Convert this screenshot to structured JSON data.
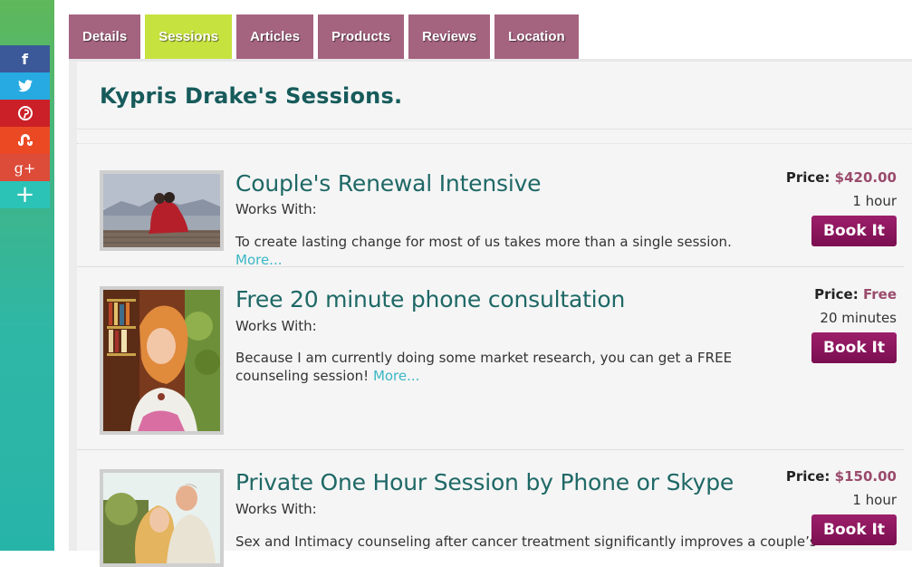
{
  "tabs": [
    {
      "label": "Details",
      "active": false
    },
    {
      "label": "Sessions",
      "active": true
    },
    {
      "label": "Articles",
      "active": false
    },
    {
      "label": "Products",
      "active": false
    },
    {
      "label": "Reviews",
      "active": false
    },
    {
      "label": "Location",
      "active": false
    }
  ],
  "social": [
    {
      "icon": "facebook-icon",
      "glyph": "f"
    },
    {
      "icon": "twitter-icon",
      "glyph": "🐦"
    },
    {
      "icon": "pinterest-icon",
      "glyph": "℗"
    },
    {
      "icon": "stumbleupon-icon",
      "glyph": "su"
    },
    {
      "icon": "google-plus-icon",
      "glyph": "g+"
    },
    {
      "icon": "add-share-icon",
      "glyph": "+"
    }
  ],
  "page_title": "Kypris Drake's Sessions.",
  "sessions": [
    {
      "name": "Couple's Renewal Intensive",
      "works_with": "Works With:",
      "description": "To create lasting change for most of us takes more than a single session.",
      "more": "More...",
      "price_label": "Price:",
      "price": "$420.00",
      "duration": "1 hour",
      "book": "Book It"
    },
    {
      "name": "Free 20 minute phone consultation",
      "works_with": "Works With:",
      "description": "Because I am currently doing some market research, you can get a FREE counseling session!",
      "more": "More...",
      "price_label": "Price:",
      "price": "Free",
      "duration": "20 minutes",
      "book": "Book It"
    },
    {
      "name": "Private One Hour Session by Phone or Skype",
      "works_with": "Works With:",
      "description": "Sex and Intimacy counseling after cancer treatment significantly improves a couple’s",
      "more": "",
      "price_label": "Price:",
      "price": "$150.00",
      "duration": "1 hour",
      "book": "Book It"
    }
  ]
}
